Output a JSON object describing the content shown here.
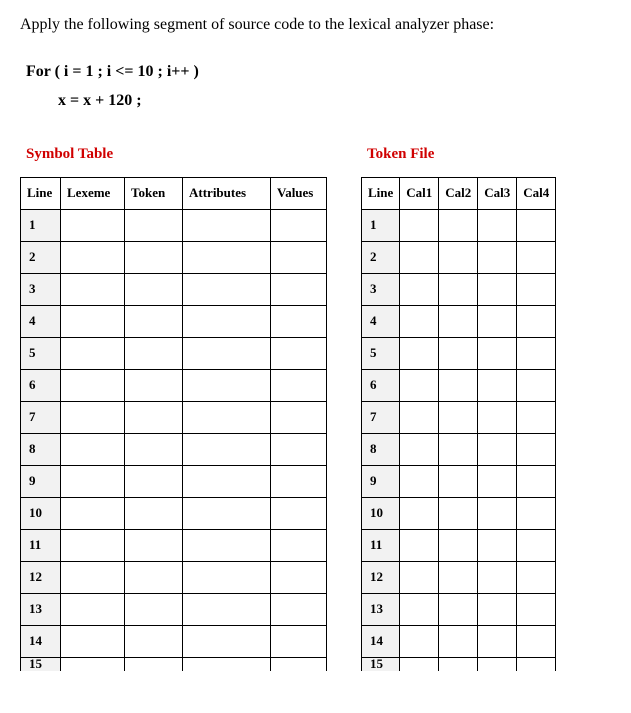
{
  "intro": "Apply the following segment of source code to the lexical analyzer phase:",
  "code": {
    "line1": "For ( i  = 1 ; i <= 10 ; i++ )",
    "line2": "x = x + 120 ;"
  },
  "symbolTable": {
    "title": "Symbol Table",
    "headers": [
      "Line",
      "Lexeme",
      "Token",
      "Attributes",
      "Values"
    ],
    "rows": [
      "1",
      "2",
      "3",
      "4",
      "5",
      "6",
      "7",
      "8",
      "9",
      "10",
      "11",
      "12",
      "13",
      "14",
      "15"
    ]
  },
  "tokenFile": {
    "title": "Token File",
    "headers": [
      "Line",
      "Cal1",
      "Cal2",
      "Cal3",
      "Cal4"
    ],
    "rows": [
      "1",
      "2",
      "3",
      "4",
      "5",
      "6",
      "7",
      "8",
      "9",
      "10",
      "11",
      "12",
      "13",
      "14",
      "15"
    ]
  }
}
